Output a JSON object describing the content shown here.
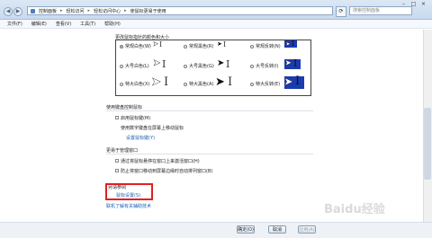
{
  "address": {
    "crumbs": [
      "控制面板",
      "轻松访问",
      "轻松访问中心",
      "使鼠标更易于使用"
    ],
    "search_placeholder": "搜索控制面板"
  },
  "menu": [
    "文件(F)",
    "编辑(E)",
    "查看(V)",
    "工具(T)",
    "帮助(H)"
  ],
  "pointer_section": {
    "title": "更改鼠标指针的颜色和大小",
    "options": [
      {
        "label": "常规白色(W)",
        "selected": true
      },
      {
        "label": "常规黑色(R)",
        "selected": false
      },
      {
        "label": "常规反转(N)",
        "selected": false
      },
      {
        "label": "大号白色(L)",
        "selected": false
      },
      {
        "label": "大号黑色(G)",
        "selected": false
      },
      {
        "label": "大号反转(I)",
        "selected": false
      },
      {
        "label": "特大白色(X)",
        "selected": false
      },
      {
        "label": "特大黑色(A)",
        "selected": false
      },
      {
        "label": "特大反转(E)",
        "selected": false
      }
    ]
  },
  "keyboard_section": {
    "title": "使用键盘控制鼠标",
    "checkbox": "启用鼠标键(M)",
    "desc": "使用数字键盘在屏幕上移动鼠标",
    "link": "设置鼠标键(Y)"
  },
  "window_section": {
    "title": "更易于管理窗口",
    "checkbox1": "通过将鼠标悬停在窗口上来激活窗口(H)",
    "checkbox2": "防止将窗口移动到屏幕边缘时自动排列窗口(B)"
  },
  "see_also": {
    "title": "另请参阅",
    "link1": "鼠标设置(S)",
    "link2": "联机了解有关辅助技术"
  },
  "buttons": {
    "ok": "确定(O)",
    "cancel": "取消",
    "apply": "应用(A)"
  },
  "watermark": "Baidu经验"
}
